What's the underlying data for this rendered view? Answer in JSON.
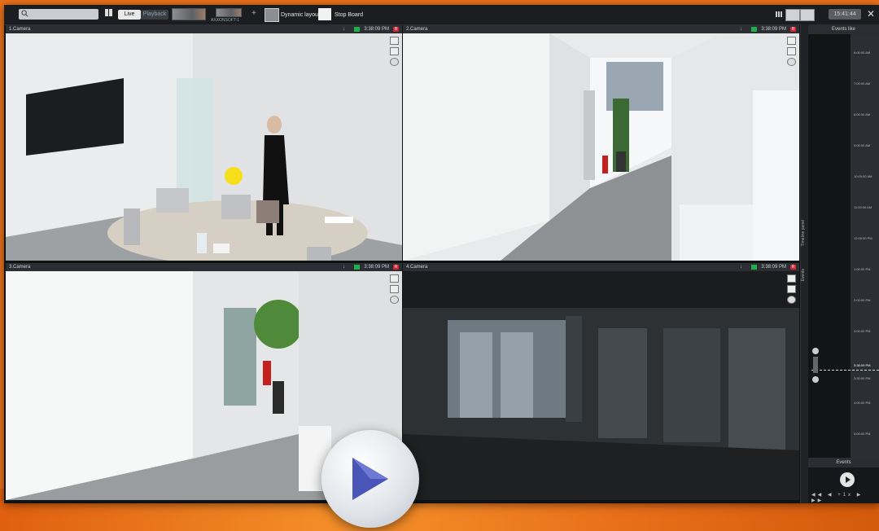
{
  "topbar": {
    "live_label": "Live",
    "playback_label": "Playback",
    "thumb_caption": "AXXONSOFT-1",
    "dynamic_layout_label": "Dynamic layout",
    "stop_board_label": "Stop Board",
    "clock": "15:41:44"
  },
  "cameras": [
    {
      "name": "1.Camera",
      "time": "3:38:09 PM",
      "rec": "R"
    },
    {
      "name": "2.Camera",
      "time": "3:38:09 PM",
      "rec": "R"
    },
    {
      "name": "3.Camera",
      "time": "3:38:09 PM",
      "rec": "R"
    },
    {
      "name": "4.Camera",
      "time": "3:38:09 PM",
      "rec": "R"
    }
  ],
  "side_panel": {
    "title": "Events like",
    "timeline_tab": "Timeline panel",
    "events_tab": "Events",
    "time_labels": [
      "6:00:00 AM",
      "7:00:00 AM",
      "8:00:00 AM",
      "9:00:00 AM",
      "10:00:00 AM",
      "11:00:00 AM",
      "12:00:00 PM",
      "1:00:00 PM",
      "2:00:00 PM",
      "3:00:00 PM",
      "3:30:00 PM",
      "4:00:00 PM",
      "5:00:00 PM"
    ],
    "current_time": "3:38:09 PM",
    "events_label": "Events",
    "speed_label": "+1x"
  },
  "colors": {
    "accent_orange": "#e8701a",
    "rec_red": "#d22233",
    "live_green": "#1db04a"
  }
}
